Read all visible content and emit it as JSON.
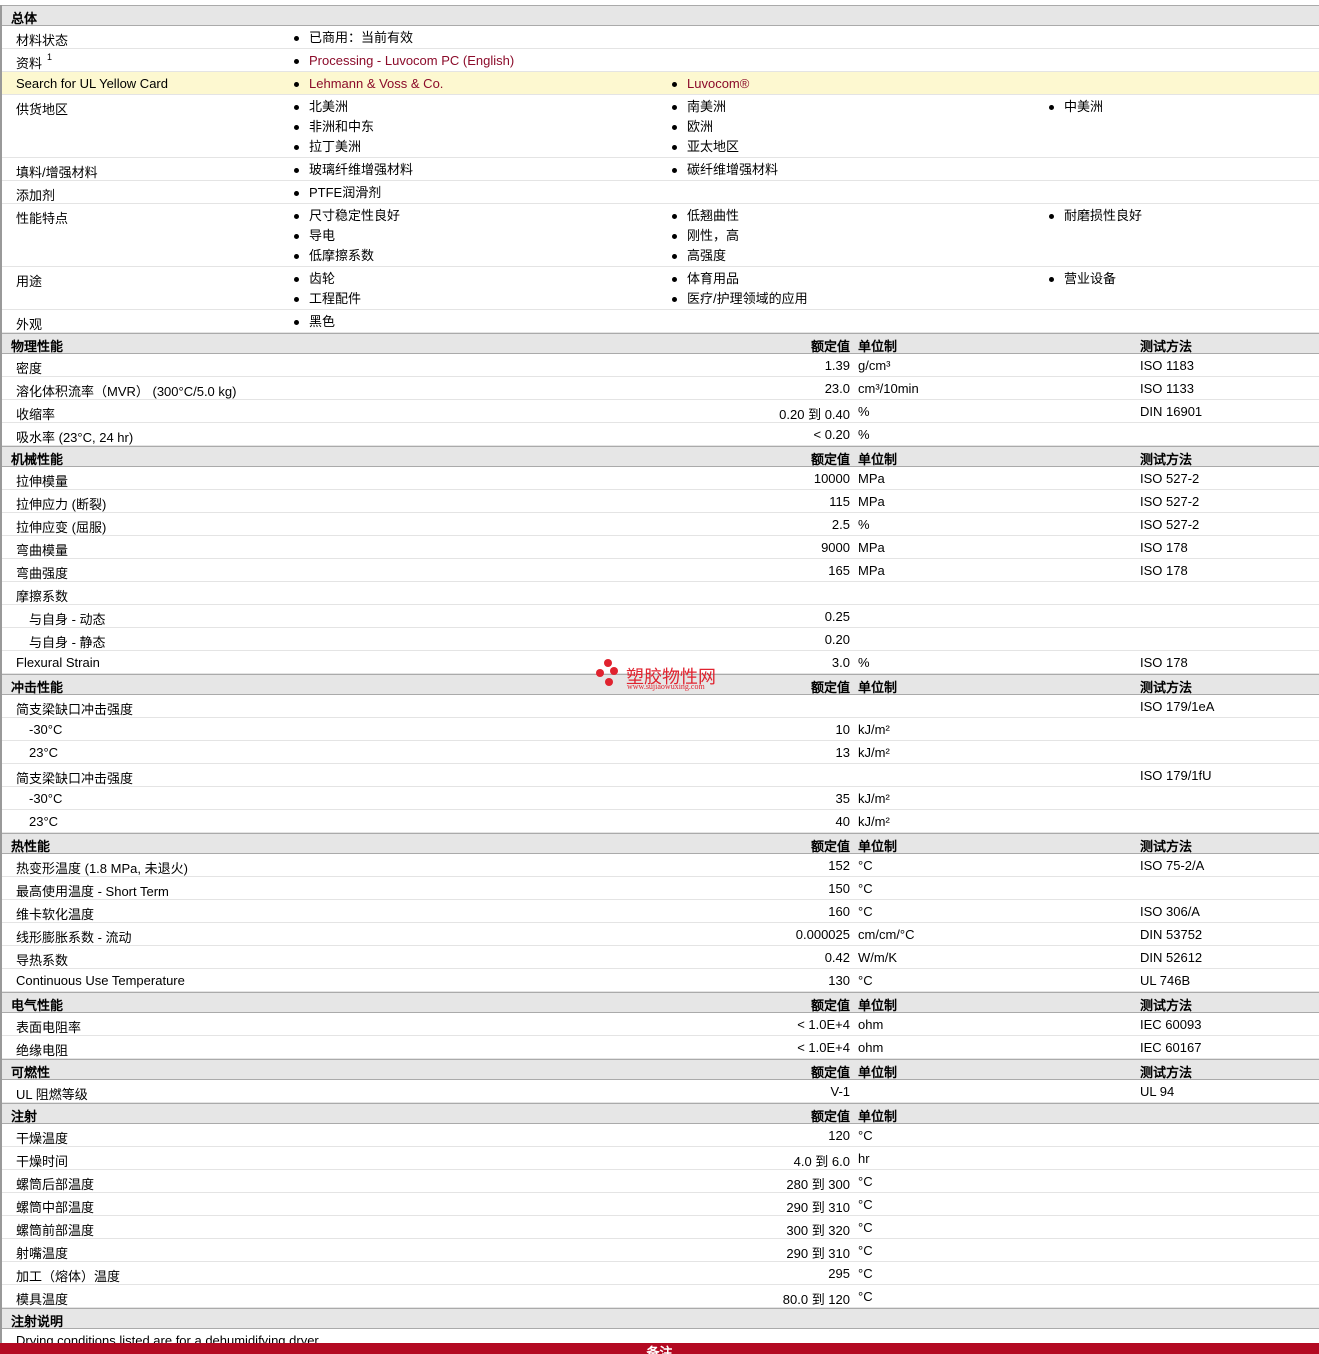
{
  "general": {
    "title": "总体",
    "rows": [
      {
        "label": "材料状态",
        "cols": [
          [
            "已商用：当前有效"
          ]
        ]
      },
      {
        "label": "资料",
        "sup": "1",
        "link": true,
        "cols": [
          [
            "Processing - Luvocom PC (English)"
          ]
        ]
      },
      {
        "label": "Search for UL Yellow Card",
        "link": true,
        "yellow": true,
        "cols": [
          [
            "Lehmann & Voss & Co."
          ],
          [
            "Luvocom®"
          ]
        ]
      },
      {
        "label": "供货地区",
        "cols": [
          [
            "北美洲",
            "非洲和中东",
            "拉丁美洲"
          ],
          [
            "南美洲",
            "欧洲",
            "亚太地区"
          ],
          [
            "中美洲"
          ]
        ]
      },
      {
        "label": "填料/增强材料",
        "cols": [
          [
            "玻璃纤维增强材料"
          ],
          [
            "碳纤维增强材料"
          ]
        ]
      },
      {
        "label": "添加剂",
        "cols": [
          [
            "PTFE润滑剂"
          ]
        ]
      },
      {
        "label": "性能特点",
        "cols": [
          [
            "尺寸稳定性良好",
            "导电",
            "低摩擦系数"
          ],
          [
            "低翘曲性",
            "刚性，高",
            "高强度"
          ],
          [
            "耐磨损性良好"
          ]
        ]
      },
      {
        "label": "用途",
        "cols": [
          [
            "齿轮",
            "工程配件"
          ],
          [
            "体育用品",
            "医疗/护理领域的应用"
          ],
          [
            "营业设备"
          ]
        ]
      },
      {
        "label": "外观",
        "cols": [
          [
            "黑色"
          ]
        ]
      }
    ]
  },
  "col_headers": {
    "value": "额定值",
    "unit": "单位制",
    "method": "测试方法"
  },
  "sections": [
    {
      "title": "物理性能",
      "method": true,
      "rows": [
        {
          "label": "密度",
          "value": "1.39",
          "unit": "g/cm³",
          "method": "ISO 1183"
        },
        {
          "label": "溶化体积流率（MVR）  (300°C/5.0 kg)",
          "value": "23.0",
          "unit": "cm³/10min",
          "method": "ISO 1133"
        },
        {
          "label": "收缩率",
          "value": "0.20 到  0.40",
          "unit": "%",
          "method": "DIN 16901"
        },
        {
          "label": "吸水率  (23°C, 24 hr)",
          "value": "< 0.20",
          "unit": "%",
          "method": ""
        }
      ]
    },
    {
      "title": "机械性能",
      "method": true,
      "rows": [
        {
          "label": "拉伸模量",
          "value": "10000",
          "unit": "MPa",
          "method": "ISO 527-2"
        },
        {
          "label": "拉伸应力  (断裂)",
          "value": "115",
          "unit": "MPa",
          "method": "ISO 527-2"
        },
        {
          "label": "拉伸应变  (屈服)",
          "value": "2.5",
          "unit": "%",
          "method": "ISO 527-2"
        },
        {
          "label": "弯曲模量",
          "value": "9000",
          "unit": "MPa",
          "method": "ISO 178"
        },
        {
          "label": "弯曲强度",
          "value": "165",
          "unit": "MPa",
          "method": "ISO 178"
        },
        {
          "label": "摩擦系数",
          "value": "",
          "unit": "",
          "method": ""
        },
        {
          "label": "与自身  - 动态",
          "indent": true,
          "value": "0.25",
          "unit": "",
          "method": ""
        },
        {
          "label": "与自身  - 静态",
          "indent": true,
          "value": "0.20",
          "unit": "",
          "method": ""
        },
        {
          "label": "Flexural Strain",
          "value": "3.0",
          "unit": "%",
          "method": "ISO 178"
        }
      ]
    },
    {
      "title": "冲击性能",
      "method": true,
      "rows": [
        {
          "label": "简支梁缺口冲击强度",
          "value": "",
          "unit": "",
          "method": "ISO 179/1eA"
        },
        {
          "label": "-30°C",
          "indent": true,
          "value": "10",
          "unit": "kJ/m²",
          "method": ""
        },
        {
          "label": "23°C",
          "indent": true,
          "value": "13",
          "unit": "kJ/m²",
          "method": ""
        },
        {
          "label": "简支梁缺口冲击强度",
          "value": "",
          "unit": "",
          "method": "ISO 179/1fU"
        },
        {
          "label": "-30°C",
          "indent": true,
          "value": "35",
          "unit": "kJ/m²",
          "method": ""
        },
        {
          "label": "23°C",
          "indent": true,
          "value": "40",
          "unit": "kJ/m²",
          "method": ""
        }
      ]
    },
    {
      "title": "热性能",
      "method": true,
      "rows": [
        {
          "label": "热变形温度  (1.8 MPa, 未退火)",
          "value": "152",
          "unit": "°C",
          "method": "ISO 75-2/A"
        },
        {
          "label": "最高使用温度  - Short Term",
          "value": "150",
          "unit": "°C",
          "method": ""
        },
        {
          "label": "维卡软化温度",
          "value": "160",
          "unit": "°C",
          "method": "ISO 306/A"
        },
        {
          "label": "线形膨胀系数  - 流动",
          "value": "0.000025",
          "unit": "cm/cm/°C",
          "method": "DIN 53752"
        },
        {
          "label": "导热系数",
          "value": "0.42",
          "unit": "W/m/K",
          "method": "DIN 52612"
        },
        {
          "label": "Continuous Use Temperature",
          "value": "130",
          "unit": "°C",
          "method": "UL 746B"
        }
      ]
    },
    {
      "title": "电气性能",
      "method": true,
      "rows": [
        {
          "label": "表面电阻率",
          "value": "< 1.0E+4",
          "unit": "ohm",
          "method": "IEC 60093"
        },
        {
          "label": "绝缘电阻",
          "value": "< 1.0E+4",
          "unit": "ohm",
          "method": "IEC 60167"
        }
      ]
    },
    {
      "title": "可燃性",
      "method": true,
      "rows": [
        {
          "label": "UL 阻燃等级",
          "value": "V-1",
          "unit": "",
          "method": "UL 94"
        }
      ]
    },
    {
      "title": "注射",
      "method": false,
      "rows": [
        {
          "label": "干燥温度",
          "value": "120",
          "unit": "°C",
          "method": ""
        },
        {
          "label": "干燥时间",
          "value": "4.0 到  6.0",
          "unit": "hr",
          "method": ""
        },
        {
          "label": "螺筒后部温度",
          "value": "280 到  300",
          "unit": "°C",
          "method": ""
        },
        {
          "label": "螺筒中部温度",
          "value": "290 到  310",
          "unit": "°C",
          "method": ""
        },
        {
          "label": "螺筒前部温度",
          "value": "300 到  320",
          "unit": "°C",
          "method": ""
        },
        {
          "label": "射嘴温度",
          "value": "290 到  310",
          "unit": "°C",
          "method": ""
        },
        {
          "label": "加工（熔体）温度",
          "value": "295",
          "unit": "°C",
          "method": ""
        },
        {
          "label": "模具温度",
          "value": "80.0 到  120",
          "unit": "°C",
          "method": ""
        }
      ]
    }
  ],
  "notes": {
    "title": "注射说明",
    "text": "Drying conditions listed are for a dehumidifying dryer."
  },
  "footer": "备注",
  "watermark": {
    "name": "塑胶物性网",
    "url": "www.sujiaowuxing.com"
  }
}
